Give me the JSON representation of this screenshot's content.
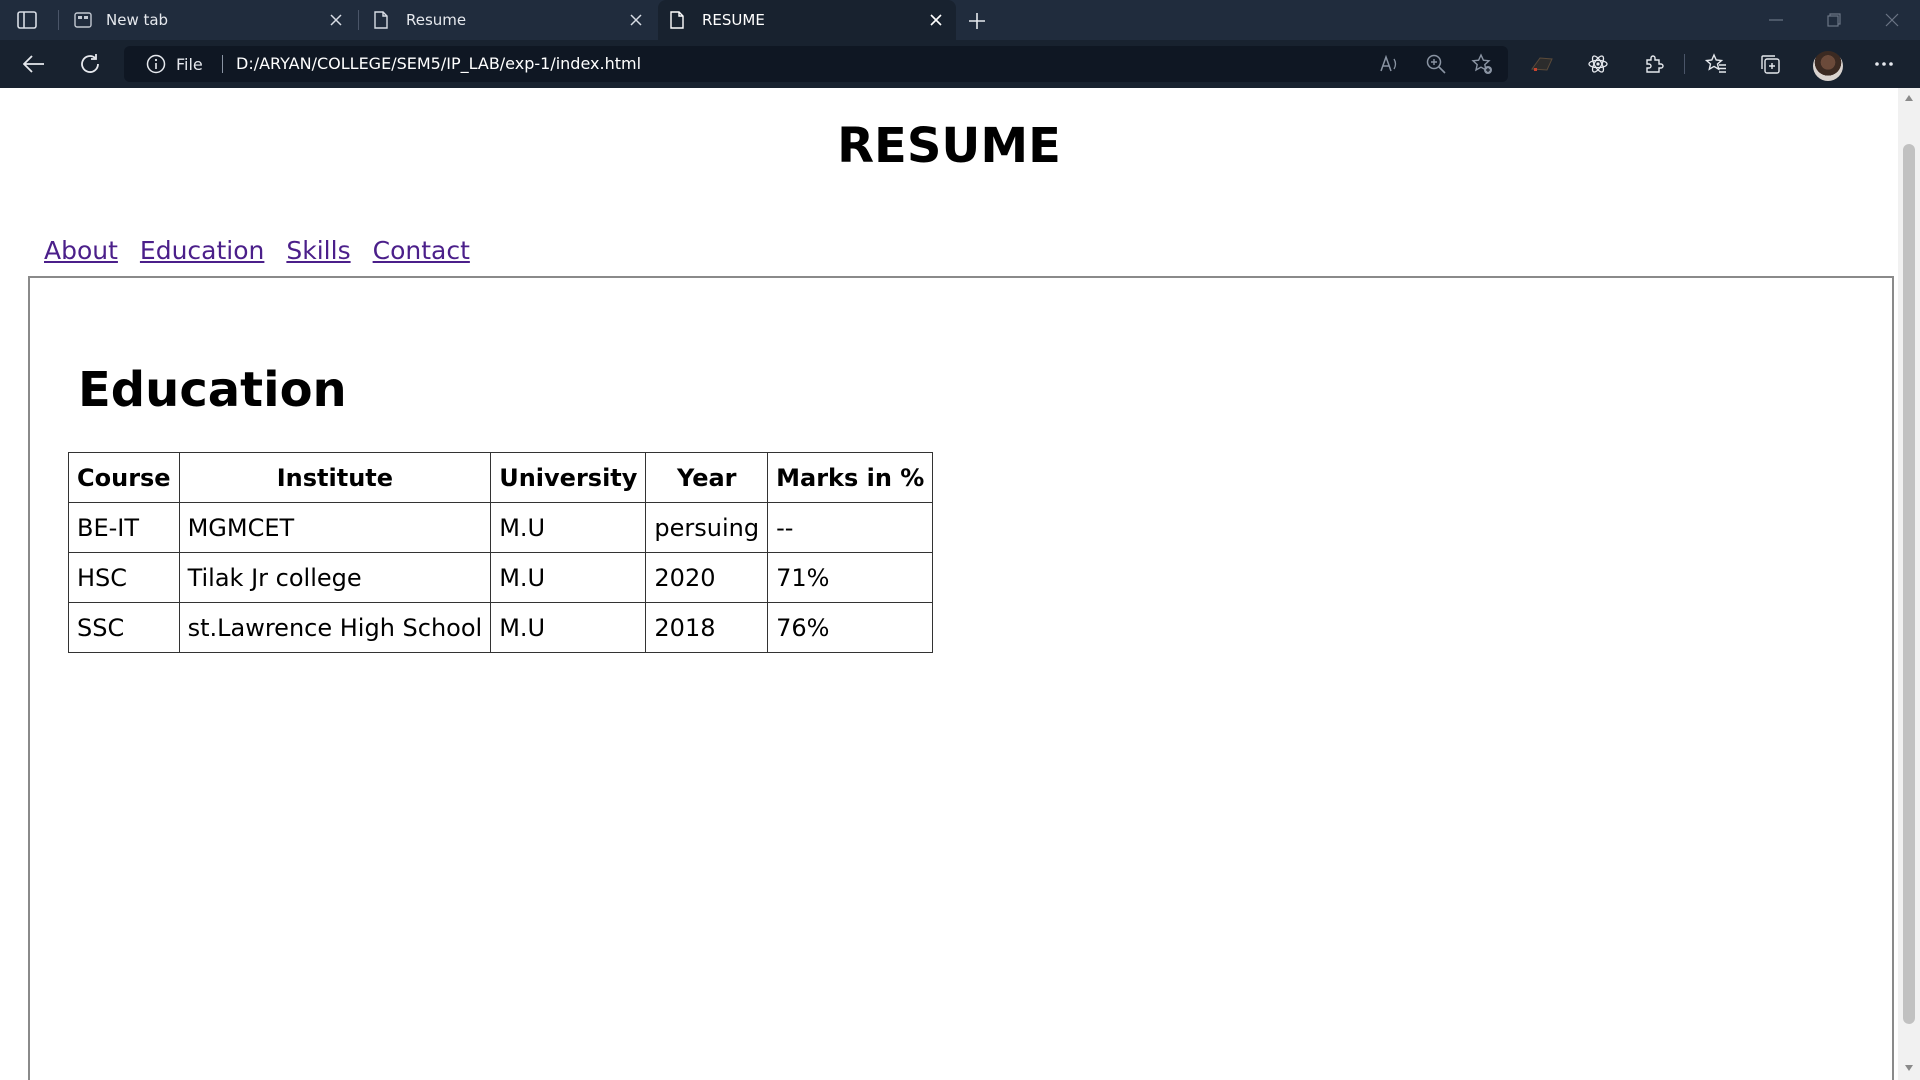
{
  "browser": {
    "tabs": [
      {
        "title": "New tab",
        "icon": "new-tab-page-icon",
        "active": false
      },
      {
        "title": "Resume",
        "icon": "document-icon",
        "active": false
      },
      {
        "title": "RESUME",
        "icon": "document-icon",
        "active": true
      }
    ],
    "address": {
      "site_info_label": "File",
      "url": "D:/ARYAN/COLLEGE/SEM5/IP_LAB/exp-1/index.html"
    }
  },
  "page": {
    "title": "RESUME",
    "nav": [
      "About",
      "Education",
      "Skills",
      "Contact"
    ],
    "section": {
      "heading": "Education",
      "table": {
        "headers": [
          "Course",
          "Institute",
          "University",
          "Year",
          "Marks in %"
        ],
        "rows": [
          [
            "BE-IT",
            "MGMCET",
            "M.U",
            "persuing",
            "--"
          ],
          [
            "HSC",
            "Tilak Jr college",
            "M.U",
            "2020",
            "71%"
          ],
          [
            "SSC",
            "st.Lawrence High School",
            "M.U",
            "2018",
            "76%"
          ]
        ]
      }
    }
  },
  "colors": {
    "chrome_bg": "#202c3d",
    "toolbar_bg": "#18222f",
    "link": "#4b1f8a"
  }
}
